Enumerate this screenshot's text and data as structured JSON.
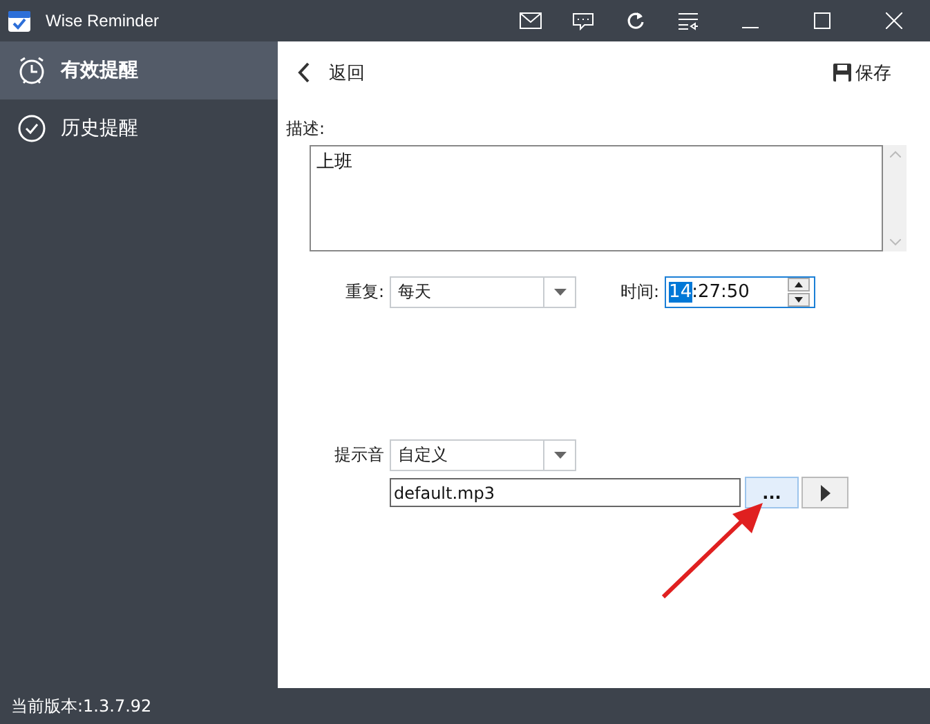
{
  "window": {
    "title": "Wise Reminder"
  },
  "sidebar": {
    "items": [
      {
        "label": "有效提醒",
        "kind": "alarm",
        "selected": true
      },
      {
        "label": "历史提醒",
        "kind": "check",
        "selected": false
      }
    ]
  },
  "header": {
    "back": "返回",
    "save": "保存"
  },
  "description": {
    "label": "描述:",
    "value": "上班"
  },
  "repeat": {
    "label": "重复:",
    "value": "每天"
  },
  "time": {
    "label": "时间:",
    "parts": [
      {
        "text": "14",
        "selected": true
      },
      {
        "text": ":27:50",
        "selected": false
      }
    ]
  },
  "sound": {
    "label": "提示音",
    "value": "自定义",
    "file": "default.mp3",
    "browse": "..."
  },
  "status_bar": {
    "version": "当前版本:1.3.7.92"
  }
}
